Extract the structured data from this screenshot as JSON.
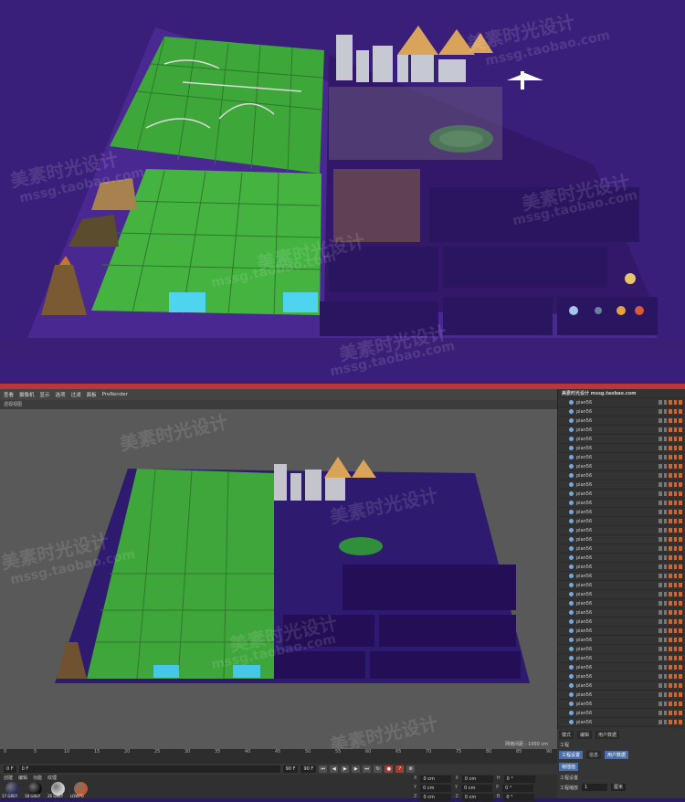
{
  "menu": {
    "items": [
      "查看",
      "摄像机",
      "显示",
      "选项",
      "过滤",
      "面板",
      "ProRender"
    ]
  },
  "viewport": {
    "label": "透视视图",
    "grid_readout": "网格间距 : 1000 cm"
  },
  "objects": {
    "root_label": "美素时光设计",
    "root_subtitle": "mssg.taobao.com",
    "child_label": "pian56",
    "rows": 36
  },
  "timeline": {
    "ticks": [
      "0",
      "5",
      "10",
      "15",
      "20",
      "25",
      "30",
      "35",
      "40",
      "45",
      "50",
      "55",
      "60",
      "65",
      "70",
      "75",
      "80",
      "85",
      "90"
    ],
    "frame_end": "0 F"
  },
  "transport": {
    "start_field": "0 F",
    "current_field": "0 F",
    "end_field": "90 F",
    "end_field2": "90 F"
  },
  "materials": {
    "tabs": [
      "创建",
      "编辑",
      "功能",
      "纹理"
    ],
    "items": [
      {
        "label": "17 GREY",
        "color": "#2a2a5e"
      },
      {
        "label": "18 GREY",
        "color": "#111111"
      },
      {
        "label": "26 GREY",
        "color": "#cfcfcf"
      },
      {
        "label": "LOWPO",
        "color": "#c8532e"
      }
    ]
  },
  "coords": {
    "rows": [
      {
        "a": "X",
        "av": "0 cm",
        "b": "X",
        "bv": "0 cm",
        "c": "H",
        "cv": "0 °"
      },
      {
        "a": "Y",
        "av": "0 cm",
        "b": "Y",
        "bv": "0 cm",
        "c": "P",
        "cv": "0 °"
      },
      {
        "a": "Z",
        "av": "0 cm",
        "b": "Z",
        "bv": "0 cm",
        "c": "B",
        "cv": "0 °"
      }
    ]
  },
  "attributes": {
    "tabs": [
      "模式",
      "编辑",
      "用户数据"
    ],
    "section": "工程",
    "subtabs": [
      "工程设置",
      "信息",
      "用户数据"
    ],
    "subtab2": "帧插值",
    "heading": "工程设置",
    "field_label": "工程缩放",
    "field_value": "1",
    "unit": "厘米"
  },
  "watermarks": {
    "cn": "美素时光设计",
    "url": "mssg.taobao.com"
  }
}
